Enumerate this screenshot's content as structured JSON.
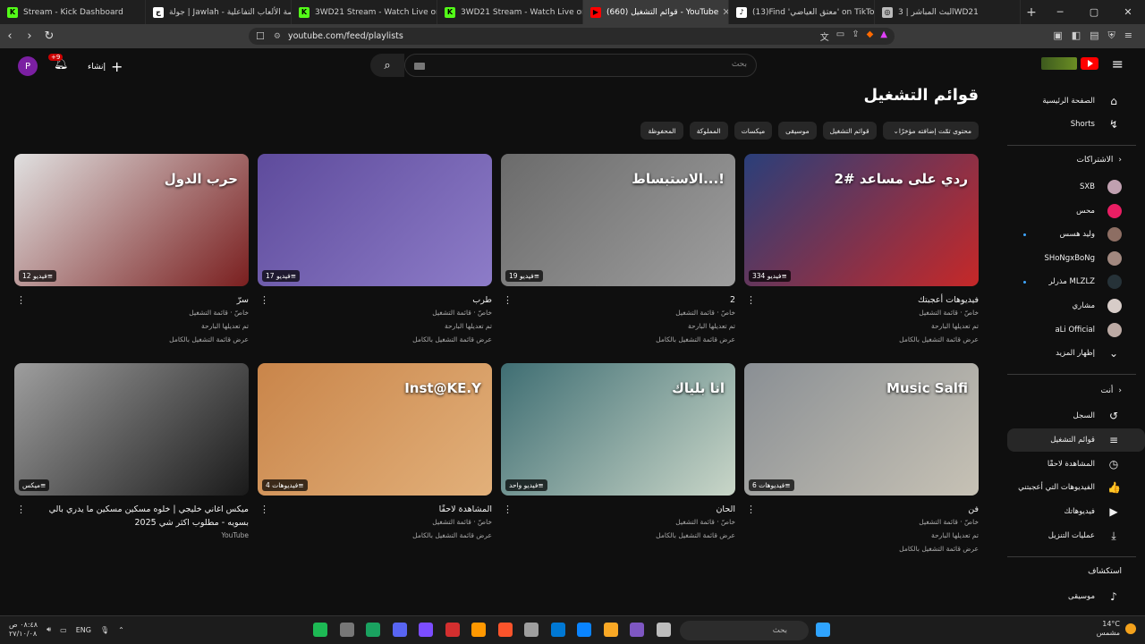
{
  "browser": {
    "tabs": [
      {
        "title": "Stream - Kick Dashboard",
        "color": "#53fc18",
        "glyph": "K",
        "active": false
      },
      {
        "title": "جولة | Jawlah - منصة الألعاب التفاعلية",
        "color": "#ffffff",
        "glyph": "ج",
        "active": false
      },
      {
        "title": "3WD21 Stream - Watch Live on K",
        "color": "#53fc18",
        "glyph": "K",
        "active": false
      },
      {
        "title": "3WD21 Stream - Watch Live on Kick",
        "color": "#53fc18",
        "glyph": "K",
        "active": false
      },
      {
        "title": "(660) قوائم التشغيل - YouTube",
        "color": "#ff0000",
        "glyph": "▶",
        "active": true
      },
      {
        "title": "(13)Find 'معتق العياضي' on TikTok | Ti",
        "color": "#ffffff",
        "glyph": "♪",
        "active": false
      },
      {
        "title": "البث المباشر | 3WD21",
        "color": "#bbbbbb",
        "glyph": "◎",
        "active": false
      }
    ],
    "url": "youtube.com/feed/playlists"
  },
  "masthead": {
    "search_placeholder": "بحث",
    "create_label": "إنشاء",
    "notifications_badge": "+9",
    "avatar_letter": "P"
  },
  "sidebar": {
    "home": "الصفحة الرئيسية",
    "shorts": "Shorts",
    "subscriptions_header": "الاشتراكات",
    "channels": [
      {
        "name": "SXB",
        "color": "#c0a0b0",
        "dot": false
      },
      {
        "name": "محس",
        "color": "#e91e63",
        "dot": false
      },
      {
        "name": "وليد هسس",
        "color": "#8d6e63",
        "dot": true
      },
      {
        "name": "SHoNgxBoNg",
        "color": "#a1887f",
        "dot": false
      },
      {
        "name": "مذرلر MLZLZ",
        "color": "#263238",
        "dot": true
      },
      {
        "name": "مشاري",
        "color": "#d7ccc8",
        "dot": false
      },
      {
        "name": "aLi Official",
        "color": "#bcaaa4",
        "dot": false
      }
    ],
    "show_more": "إظهار المزيد",
    "you_header": "أنت",
    "you_items": [
      {
        "label": "السجل",
        "icon": "history-icon",
        "glyph": "↺",
        "active": false
      },
      {
        "label": "قوائم التشغيل",
        "icon": "playlists-icon",
        "glyph": "≡",
        "active": true
      },
      {
        "label": "المشاهدة لاحقًا",
        "icon": "watch-later-icon",
        "glyph": "◷",
        "active": false
      },
      {
        "label": "الفيديوهات التي أعجبتني",
        "icon": "like-icon",
        "glyph": "👍",
        "active": false
      },
      {
        "label": "فيديوهاتك",
        "icon": "your-videos-icon",
        "glyph": "▶",
        "active": false
      },
      {
        "label": "عمليات التنزيل",
        "icon": "download-icon",
        "glyph": "⤓",
        "active": false
      }
    ],
    "explore_header": "استكشاف",
    "explore_items": [
      {
        "label": "موسيقى",
        "icon": "music-icon",
        "glyph": "♪"
      }
    ]
  },
  "main": {
    "title": "قوائم التشغيل",
    "chips": [
      "محتوى تمّت إضافته مؤخرًا",
      "قوائم التشغيل",
      "موسيقى",
      "ميكسات",
      "المملوكة",
      "المحفوظة"
    ],
    "playlists": [
      {
        "title": "فيديوهات أعجبتك",
        "count": "334 فيديو",
        "meta1": "خاصّ · قائمة التشغيل",
        "meta2": "تم تعديلها البارحة",
        "link": "عرض قائمة التشغيل بالكامل",
        "thumb_text": "ردي على مساعد #2",
        "bg": "#2a3f7a",
        "bg2": "#c62828"
      },
      {
        "title": "2",
        "count": "19 فيديو",
        "meta1": "خاصّ · قائمة التشغيل",
        "meta2": "تم تعديلها البارحة",
        "link": "عرض قائمة التشغيل بالكامل",
        "thumb_text": "الاستبساط...!",
        "bg": "#6b6b6b",
        "bg2": "#9e9e9e"
      },
      {
        "title": "طرب",
        "count": "17 فيديو",
        "meta1": "خاصّ · قائمة التشغيل",
        "meta2": "تم تعديلها البارحة",
        "link": "عرض قائمة التشغيل بالكامل",
        "thumb_text": "",
        "bg": "#5e4b9c",
        "bg2": "#8d7cc8"
      },
      {
        "title": "سرّ",
        "count": "12 فيديو",
        "meta1": "خاصّ · قائمة التشغيل",
        "meta2": "تم تعديلها البارحة",
        "link": "عرض قائمة التشغيل بالكامل",
        "thumb_text": "حرب الدول",
        "bg": "#e0e0e0",
        "bg2": "#7a1f1f"
      },
      {
        "title": "فن",
        "count": "6 فيديوهات",
        "meta1": "خاصّ · قائمة التشغيل",
        "meta2": "تم تعديلها البارحة",
        "link": "عرض قائمة التشغيل بالكامل",
        "thumb_text": "Music Salfi",
        "bg": "#8a8f94",
        "bg2": "#c7c2b5"
      },
      {
        "title": "الحان",
        "count": "فيديو واحد",
        "meta1": "خاصّ · قائمة التشغيل",
        "meta2": "",
        "link": "عرض قائمة التشغيل بالكامل",
        "thumb_text": "انا بلياك",
        "bg": "#3f6e73",
        "bg2": "#c9d6c8"
      },
      {
        "title": "المشاهدة لاحقًا",
        "count": "4 فيديوهات",
        "meta1": "خاصّ · قائمة التشغيل",
        "meta2": "",
        "link": "عرض قائمة التشغيل بالكامل",
        "thumb_text": "Inst@KE.Y",
        "bg": "#c9854a",
        "bg2": "#e2b07a"
      },
      {
        "title": "ميكس اغاني خليجي | خلوه مسكين مسكين ما يدري بالي بسويه - مطلوب اكثر شي 2025",
        "count": "ميكس",
        "meta1": "YouTube",
        "meta2": "",
        "link": "",
        "thumb_text": "",
        "bg": "#9e9e9e",
        "bg2": "#1a1a1a"
      }
    ]
  },
  "taskbar": {
    "search_label": "بحث",
    "lang": "ENG",
    "time": "٠٨:٤٨ ص",
    "date": "٢٧/١٠/٠٨",
    "temp": "14°C",
    "weather": "مشمس"
  }
}
